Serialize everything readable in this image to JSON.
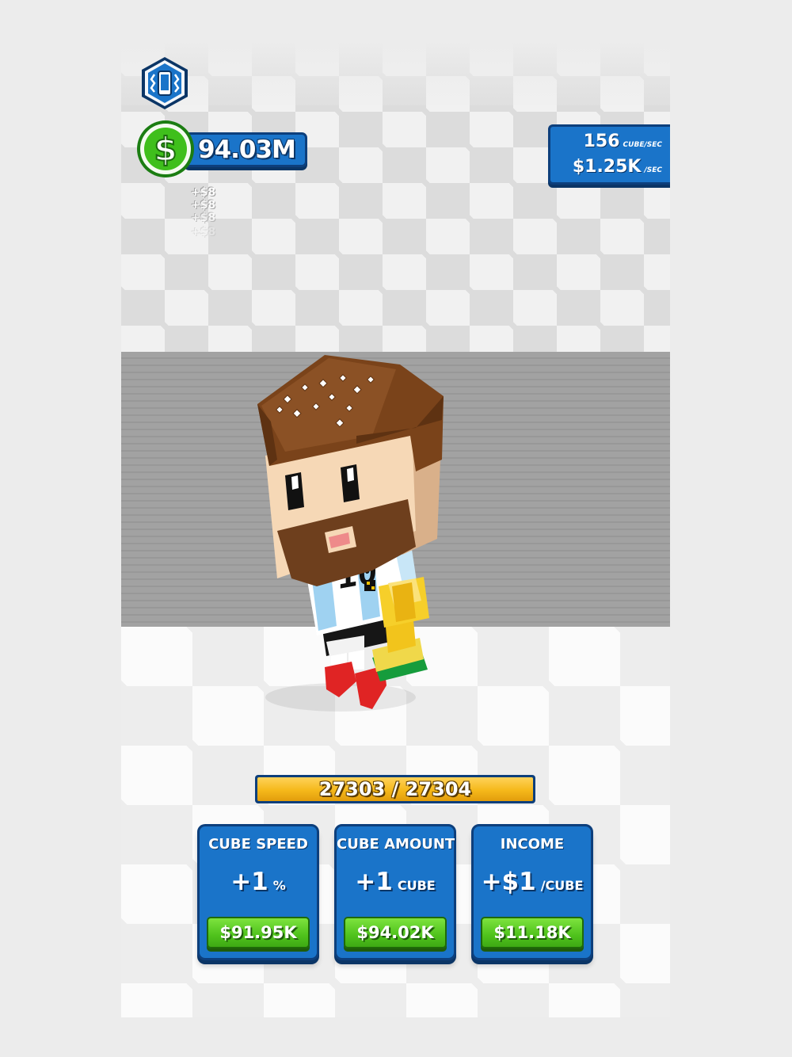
{
  "hud": {
    "vibrate_icon": "vibration-phone-icon",
    "money_icon": "dollar-coin-icon",
    "money": "94.03M",
    "floating_gains": [
      "+$8",
      "+$8",
      "+$8",
      "+$8"
    ]
  },
  "stats": {
    "cubes_per_sec_value": "156",
    "cubes_per_sec_unit": "CUBE/SEC",
    "money_per_sec_value": "$1.25K",
    "money_per_sec_unit": "/SEC"
  },
  "progress": {
    "current": 27303,
    "total": 27304,
    "label": "27303 / 27304"
  },
  "upgrades": [
    {
      "title": "CUBE SPEED",
      "value": "+1",
      "unit": "%",
      "price": "$91.95K"
    },
    {
      "title": "CUBE AMOUNT",
      "value": "+1",
      "unit": "CUBE",
      "price": "$94.02K"
    },
    {
      "title": "INCOME",
      "value": "+$1",
      "unit": "/CUBE",
      "price": "$11.18K"
    }
  ],
  "colors": {
    "panel_blue": "#1a74c9",
    "panel_border": "#0d3f7c",
    "buy_green": "#4fc21c",
    "progress_yellow": "#f5b81a"
  }
}
